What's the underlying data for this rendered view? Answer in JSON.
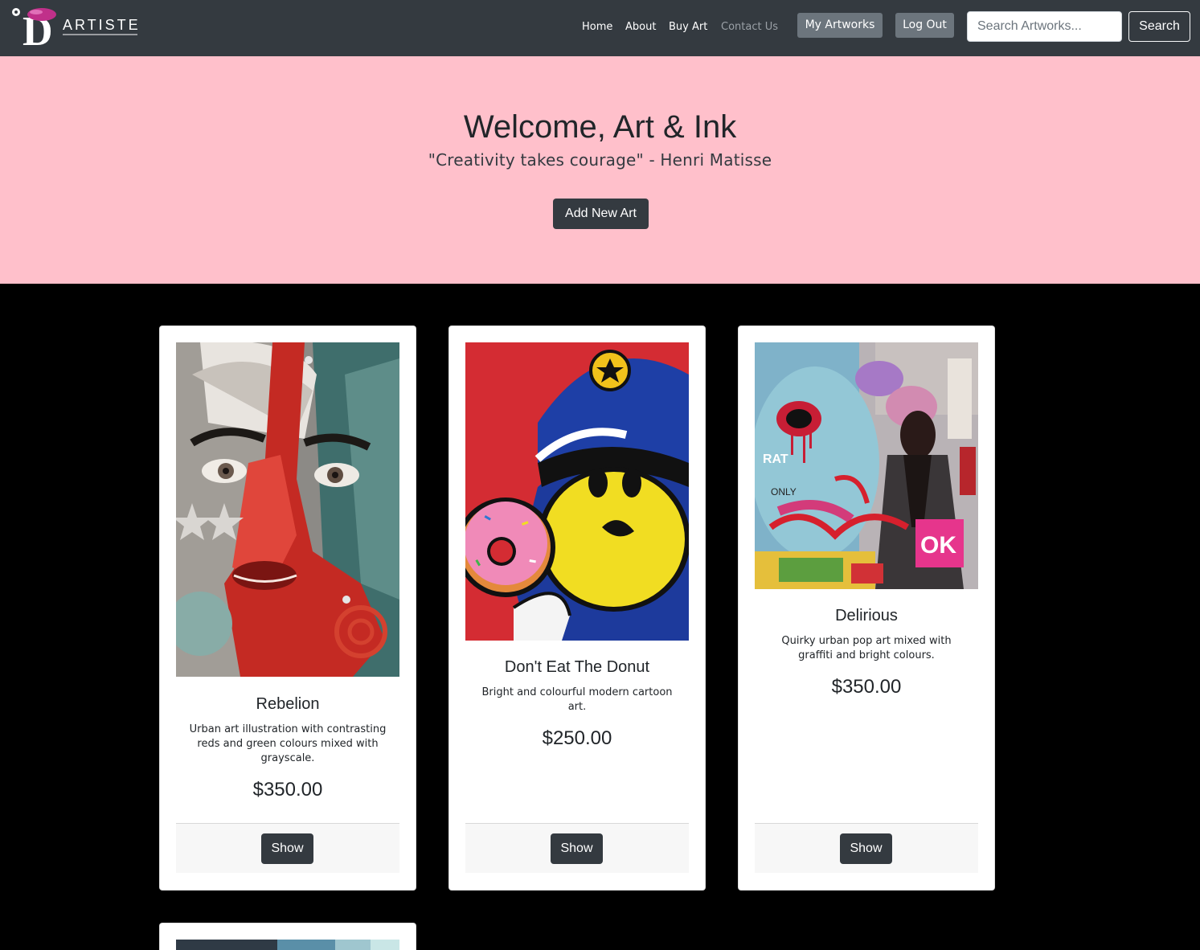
{
  "nav": {
    "brand_letter": "D",
    "brand_text": "ARTISTE",
    "links": [
      {
        "label": "Home"
      },
      {
        "label": "About"
      },
      {
        "label": "Buy Art"
      },
      {
        "label": "Contact Us"
      }
    ],
    "my_artworks_label": "My Artworks",
    "logout_label": "Log Out",
    "search_placeholder": "Search Artworks...",
    "search_button_label": "Search",
    "colors": {
      "bar": "#343a40",
      "secondary_button": "#6c757d",
      "logo_accent": "#c0308a"
    }
  },
  "hero": {
    "title": "Welcome, Art & Ink",
    "quote": "\"Creativity takes courage\" - Henri Matisse",
    "add_button_label": "Add New Art",
    "background": "#ffc0cb"
  },
  "cards": [
    {
      "image_name": "rebelion-artwork-image",
      "title": "Rebelion",
      "description": "Urban art illustration with contrasting reds and green colours mixed with grayscale.",
      "price": "$350.00",
      "button_label": "Show"
    },
    {
      "image_name": "donut-artwork-image",
      "title": "Don't Eat The Donut",
      "description": "Bright and colourful modern cartoon art.",
      "price": "$250.00",
      "button_label": "Show"
    },
    {
      "image_name": "delirious-artwork-image",
      "title": "Delirious",
      "description": "Quirky urban pop art mixed with graffiti and bright colours.",
      "price": "$350.00",
      "button_label": "Show"
    }
  ]
}
